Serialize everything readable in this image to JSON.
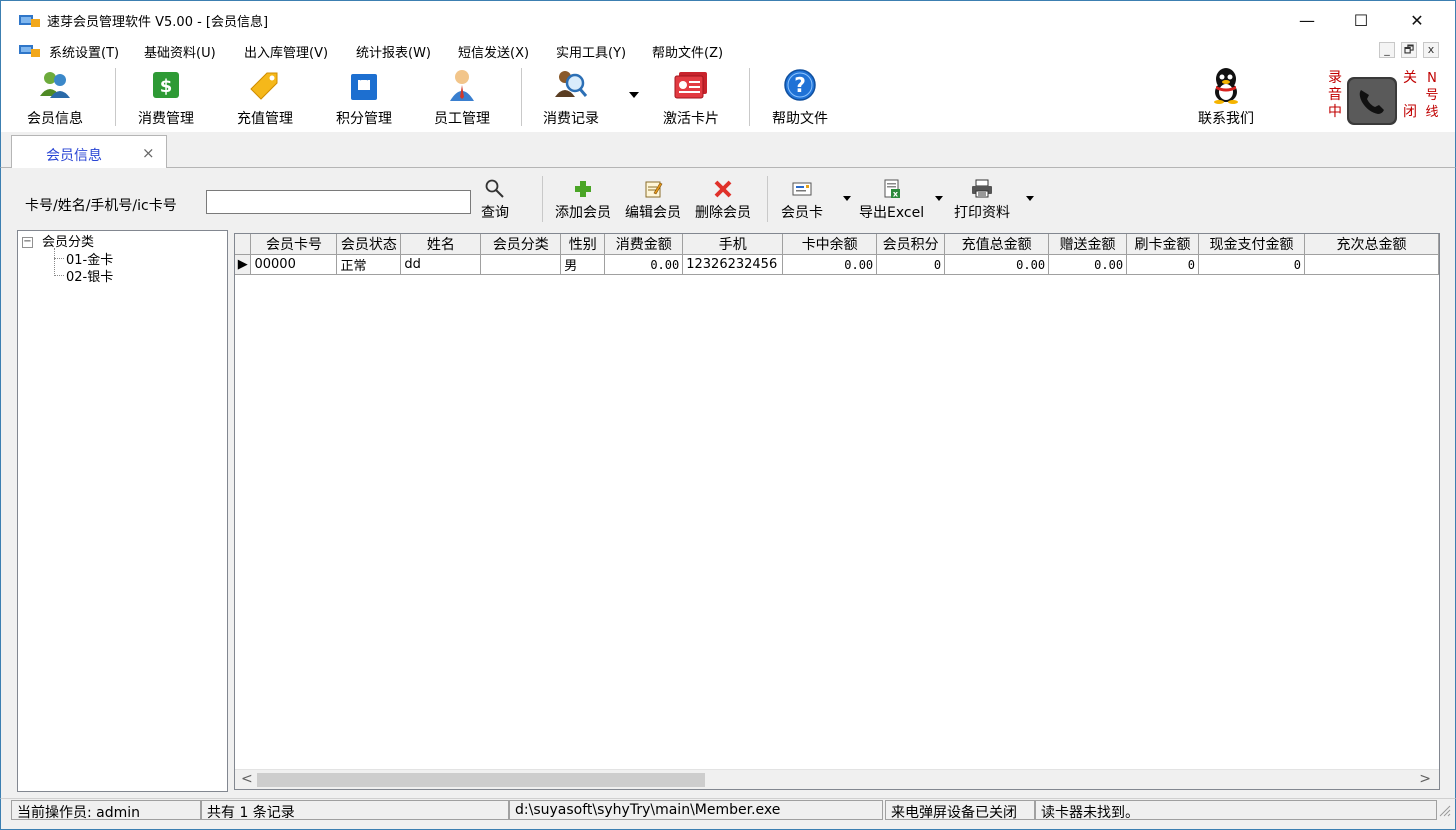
{
  "window": {
    "title": "速芽会员管理软件 V5.00 - [会员信息]",
    "minimize": "—",
    "maximize": "☐",
    "close": "✕"
  },
  "menu": {
    "items": [
      {
        "label": "系统设置(T)"
      },
      {
        "label": "基础资料(U)"
      },
      {
        "label": "出入库管理(V)"
      },
      {
        "label": "统计报表(W)"
      },
      {
        "label": "短信发送(X)"
      },
      {
        "label": "实用工具(Y)"
      },
      {
        "label": "帮助文件(Z)"
      }
    ],
    "mdi_min": "_",
    "mdi_restore": "🗗",
    "mdi_close": "x"
  },
  "toolbar": {
    "member_info": "会员信息",
    "consumption": "消费管理",
    "recharge": "充值管理",
    "points": "积分管理",
    "staff": "员工管理",
    "consume_records": "消费记录",
    "activate_card": "激活卡片",
    "help": "帮助文件",
    "contact": "联系我们",
    "record_left": [
      "录",
      "音",
      "中"
    ],
    "close_right": [
      "关",
      "闭"
    ],
    "n_right": [
      "N",
      "号",
      "线"
    ]
  },
  "tab": {
    "label": "会员信息",
    "close": "×"
  },
  "search": {
    "label": "卡号/姓名/手机号/ic卡号",
    "value": "",
    "query": "查询"
  },
  "actions": {
    "add": "添加会员",
    "edit": "编辑会员",
    "delete": "删除会员",
    "member_card": "会员卡",
    "export": "导出Excel",
    "print": "打印资料"
  },
  "tree": {
    "root": "会员分类",
    "expander": "−",
    "children": [
      {
        "label": "01-金卡"
      },
      {
        "label": "02-银卡"
      }
    ]
  },
  "grid": {
    "columns": [
      "会员卡号",
      "会员状态",
      "姓名",
      "会员分类",
      "性别",
      "消费金额",
      "手机",
      "卡中余额",
      "会员积分",
      "充值总金额",
      "赠送金额",
      "刷卡金额",
      "现金支付金额",
      "充次总金额"
    ],
    "rows": [
      {
        "marker": "▶",
        "cells": [
          "00000",
          "正常",
          "dd",
          "",
          "男",
          "0.00",
          "12326232456",
          "0.00",
          "0",
          "0.00",
          "0.00",
          "0",
          "0",
          ""
        ]
      }
    ],
    "scroll_left": "<",
    "scroll_right": ">"
  },
  "status": {
    "operator": "当前操作员: admin",
    "records": "共有 1 条记录",
    "path": "d:\\suyasoft\\syhyTry\\main\\Member.exe",
    "caller_id": "来电弹屏设备已关闭",
    "card_reader": "读卡器未找到。"
  }
}
